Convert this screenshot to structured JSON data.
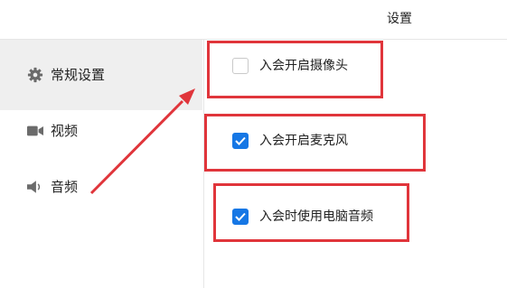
{
  "window": {
    "title": "设置"
  },
  "sidebar": {
    "items": [
      {
        "label": "常规设置",
        "icon": "gear-icon",
        "active": true
      },
      {
        "label": "视频",
        "icon": "video-camera-icon",
        "active": false
      },
      {
        "label": "音频",
        "icon": "speaker-icon",
        "active": false
      }
    ]
  },
  "options": [
    {
      "label": "入会开启摄像头",
      "checked": false
    },
    {
      "label": "入会开启麦克风",
      "checked": true
    },
    {
      "label": "入会时使用电脑音频",
      "checked": true
    }
  ],
  "colors": {
    "accent": "#1677e5",
    "highlight": "#e0353b",
    "active_bg": "#efefef"
  }
}
